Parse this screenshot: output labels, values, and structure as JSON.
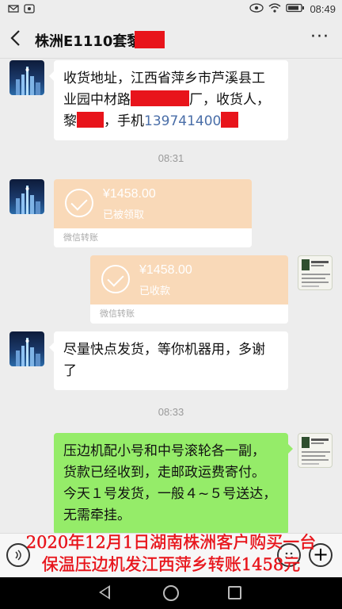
{
  "status_bar": {
    "time": "08:49",
    "left_icons": [
      "mail-icon",
      "notification-icon"
    ],
    "right_icons": [
      "eye-icon",
      "wifi-icon",
      "battery-icon"
    ]
  },
  "header": {
    "title": "株洲E1110套黎",
    "back_icon": "chevron-left-icon",
    "more_icon": "more-dots-icon",
    "more_label": "···"
  },
  "messages": [
    {
      "side": "left",
      "type": "text",
      "line1": "收货地址，江西省萍乡市芦溪县工",
      "line2_a": "业园中材路",
      "line2_b": "厂，收货人，",
      "line3_a": "黎",
      "line3_b": "，手机",
      "phone": "139741400"
    },
    {
      "type": "timestamp",
      "text": "08:31"
    },
    {
      "side": "left",
      "type": "transfer",
      "amount": "¥1458.00",
      "status": "已被领取",
      "footer": "微信转账"
    },
    {
      "side": "right",
      "type": "transfer",
      "amount": "¥1458.00",
      "status": "已收款",
      "footer": "微信转账"
    },
    {
      "side": "left",
      "type": "text",
      "line1": "尽量快点发货，等你机器用，多谢",
      "line2": "了"
    },
    {
      "type": "timestamp",
      "text": "08:33"
    },
    {
      "side": "right",
      "type": "text",
      "line1": "压边机配小号和中号滚轮各一副，",
      "line2": "货款已经收到，走邮政运费寄付。",
      "line3": "今天１号发货，一般４~５号送达，",
      "line4": "无需牵挂。"
    }
  ],
  "input_bar": {
    "voice_icon": "voice-icon",
    "emoji_icon": "emoji-icon",
    "plus_icon": "plus-icon",
    "plus_label": "+"
  },
  "caption": {
    "line1": "2020年12月1日湖南株洲客户购买一台",
    "line2": "保温压边机发江西萍乡转账1458元"
  },
  "nav_bar": {
    "icons": [
      "back-triangle-icon",
      "home-circle-icon",
      "recent-square-icon"
    ]
  },
  "colors": {
    "chat_background": "#ededed",
    "sent_bubble": "#95ec69",
    "received_bubble": "#ffffff",
    "transfer_orange": "#f9d9b8",
    "redaction_red": "#e8141b",
    "caption_red": "#e8141b",
    "phone_link": "#4a6ea8"
  }
}
